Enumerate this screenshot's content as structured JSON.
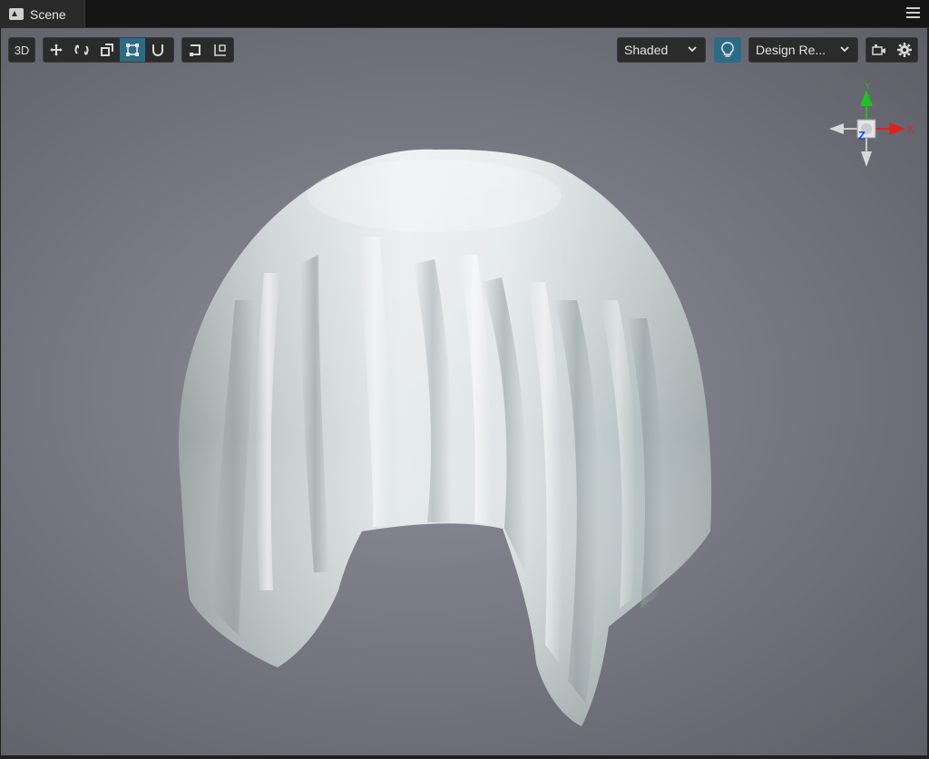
{
  "tab": {
    "label": "Scene"
  },
  "toolbar": {
    "mode_label": "3D",
    "shading_mode": "Shaded",
    "resolution_label": "Design Re..."
  },
  "gizmo": {
    "y_label": "Y",
    "x_label": "X",
    "z_label": "Z"
  },
  "colors": {
    "accent": "#2d6b85",
    "gizmo_x": "#e02020",
    "gizmo_y": "#20c020",
    "gizmo_z": "#2040e0"
  }
}
